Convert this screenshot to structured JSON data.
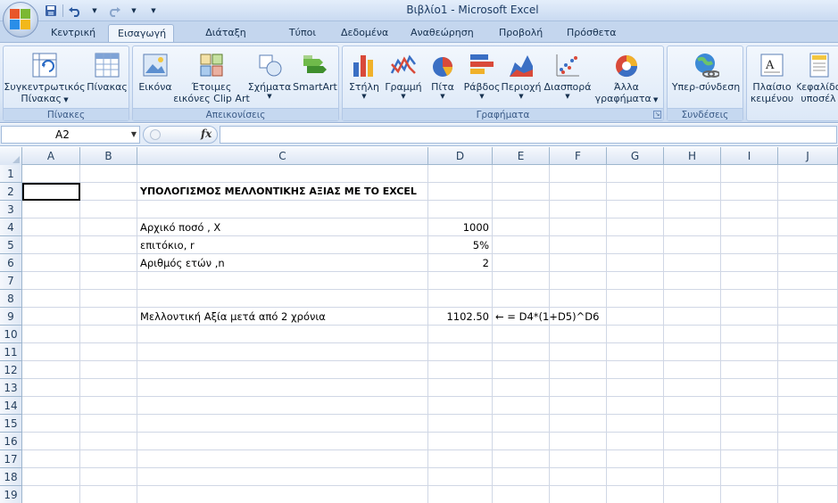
{
  "window": {
    "title": "Βιβλίο1 - Microsoft Excel"
  },
  "quick_access": [
    "save-icon",
    "undo-icon",
    "redo-icon",
    "customize-icon"
  ],
  "tabs": [
    {
      "label": "Κεντρική",
      "active": false
    },
    {
      "label": "Εισαγωγή",
      "active": true
    },
    {
      "label": "Διάταξη σελίδας",
      "active": false
    },
    {
      "label": "Τύποι",
      "active": false
    },
    {
      "label": "Δεδομένα",
      "active": false
    },
    {
      "label": "Αναθεώρηση",
      "active": false
    },
    {
      "label": "Προβολή",
      "active": false
    },
    {
      "label": "Πρόσθετα",
      "active": false
    }
  ],
  "ribbon": {
    "groups": {
      "tables": "Πίνακες",
      "illustrations": "Απεικονίσεις",
      "charts": "Γραφήματα",
      "links": "Συνδέσεις"
    },
    "buttons": {
      "pivot_line1": "Συγκεντρωτικός",
      "pivot_line2": "Πίνακας",
      "table": "Πίνακας",
      "picture": "Εικόνα",
      "clipart_line1": "Έτοιμες",
      "clipart_line2": "εικόνες Clip Art",
      "shapes": "Σχήματα",
      "smartart": "SmartArt",
      "column": "Στήλη",
      "line": "Γραμμή",
      "pie": "Πίτα",
      "bar": "Ράβδος",
      "area": "Περιοχή",
      "scatter": "Διασπορά",
      "other_line1": "Άλλα",
      "other_line2": "γραφήματα",
      "hyperlink": "Υπερ-σύνδεση",
      "textbox_line1": "Πλαίσιο",
      "textbox_line2": "κειμένου",
      "header_line1": "Κεφαλίδα",
      "header_line2": "υποσέλ"
    }
  },
  "formula_bar": {
    "name_box": "A2",
    "fx": "fx",
    "formula": ""
  },
  "columns": [
    "A",
    "B",
    "C",
    "D",
    "E",
    "F",
    "G",
    "H",
    "I",
    "J"
  ],
  "rows": [
    "1",
    "2",
    "3",
    "4",
    "5",
    "6",
    "7",
    "8",
    "9",
    "10",
    "11",
    "12",
    "13",
    "14",
    "15",
    "16",
    "17",
    "18",
    "19"
  ],
  "cells": {
    "C2": "ΥΠΟΛΟΓΙΣΜΟΣ ΜΕΛΛΟΝΤΙΚΗΣ ΑΞΙΑΣ ΜΕ ΤΟ EXCEL",
    "C4": "Αρχικό ποσό , Χ",
    "D4": "1000",
    "C5": "επιτόκιο,  r",
    "D5": "5%",
    "C6": "Αριθμός ετών ,n",
    "D6": "2",
    "C9": "Μελλοντική Αξία μετά από 2 χρόνια",
    "D9": "1102.50",
    "E9": "← = D4*(1+D5)^D6"
  },
  "active_cell": "A2"
}
